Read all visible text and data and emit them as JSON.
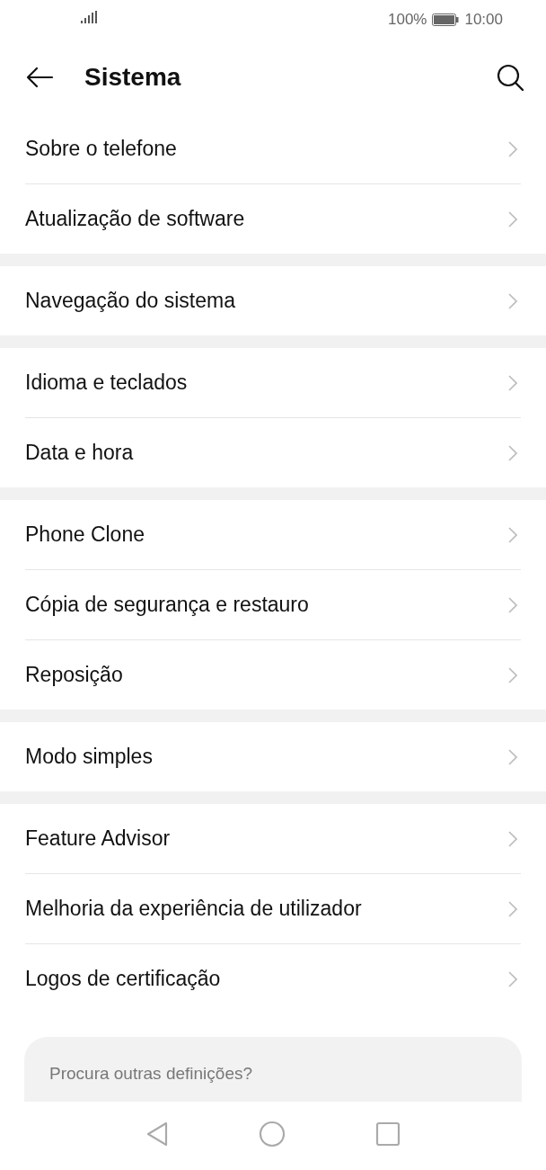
{
  "status_bar": {
    "battery": "100%",
    "time": "10:00"
  },
  "header": {
    "title": "Sistema"
  },
  "groups": [
    {
      "items": [
        "Sobre o telefone",
        "Atualização de software"
      ]
    },
    {
      "items": [
        "Navegação do sistema"
      ]
    },
    {
      "items": [
        "Idioma e teclados",
        "Data e hora"
      ]
    },
    {
      "items": [
        "Phone Clone",
        "Cópia de segurança e restauro",
        "Reposição"
      ]
    },
    {
      "items": [
        "Modo simples"
      ]
    },
    {
      "items": [
        "Feature Advisor",
        "Melhoria da experiência de utilizador",
        "Logos de certificação"
      ]
    }
  ],
  "suggestion_card": {
    "title": "Procura outras definições?"
  }
}
